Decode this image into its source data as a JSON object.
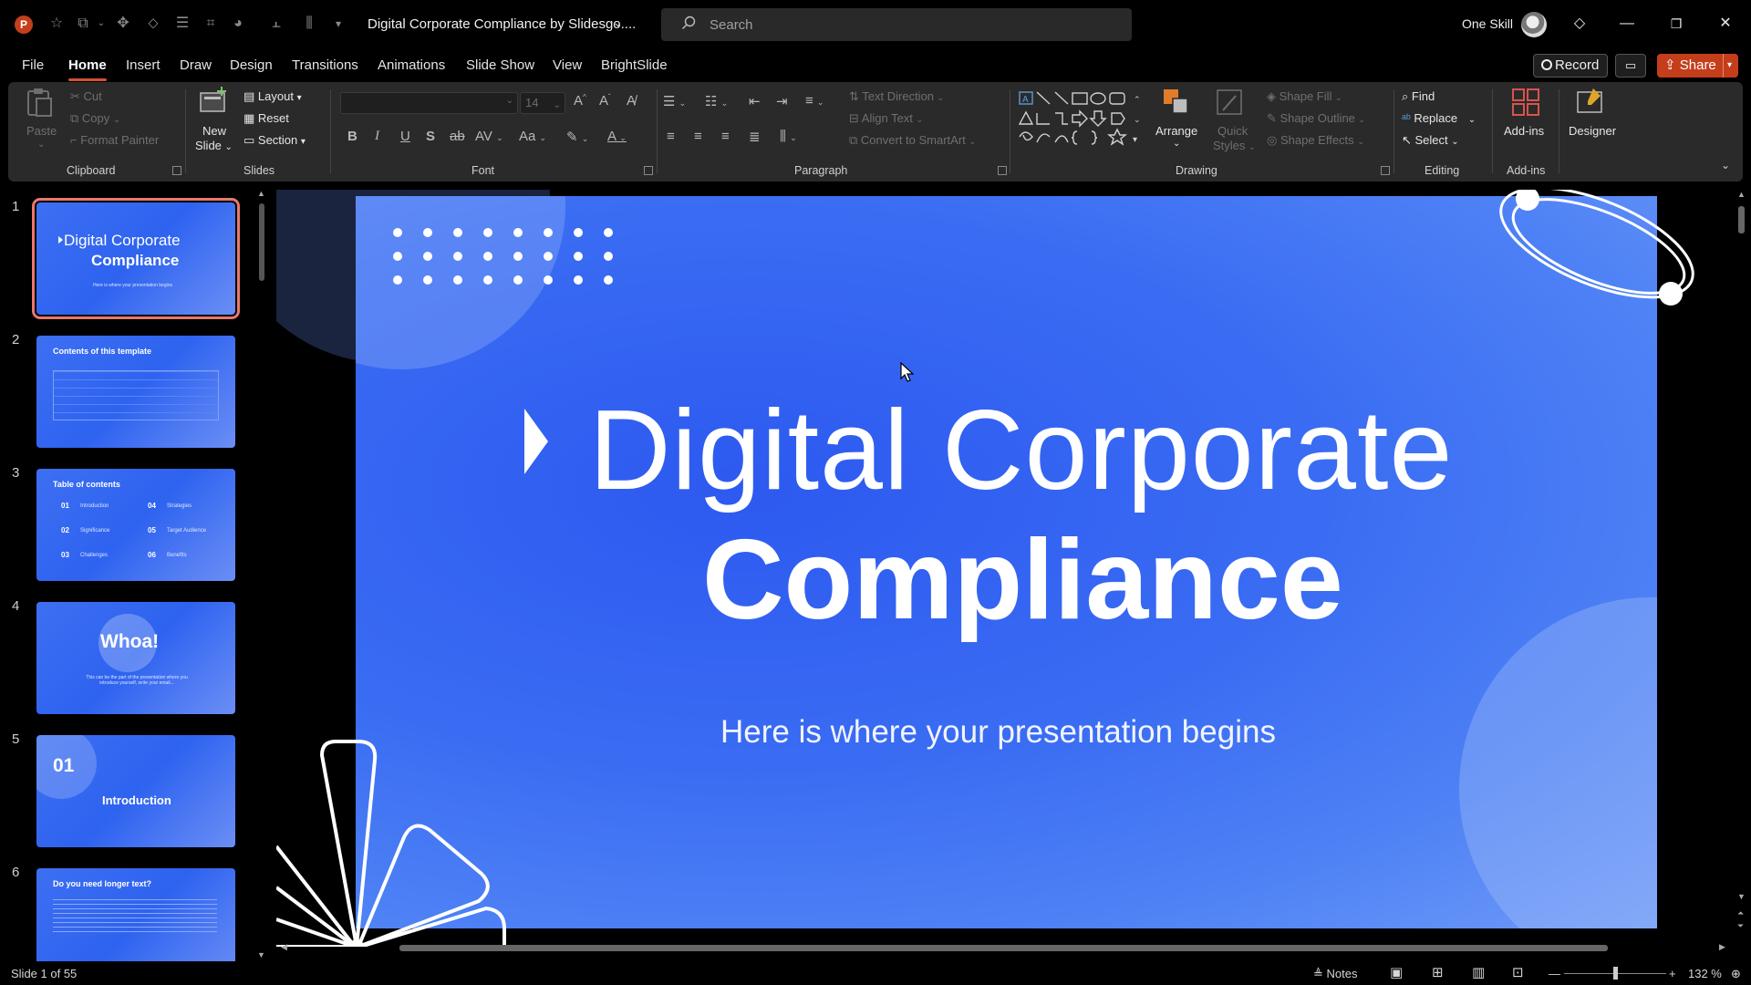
{
  "app": {
    "logo_letter": "P",
    "document_title": "Digital Corporate Compliance by Slidesgo....",
    "search_placeholder": "Search",
    "user_name": "One Skill"
  },
  "menu": {
    "tabs": [
      "File",
      "Home",
      "Insert",
      "Draw",
      "Design",
      "Transitions",
      "Animations",
      "Slide Show",
      "View",
      "BrightSlide"
    ],
    "active_tab": "Home",
    "record_label": "Record",
    "share_label": "Share"
  },
  "ribbon": {
    "clipboard": {
      "paste": "Paste",
      "cut": "Cut",
      "copy": "Copy",
      "format_painter": "Format Painter",
      "group": "Clipboard"
    },
    "slides": {
      "new_slide_1": "New",
      "new_slide_2": "Slide",
      "layout": "Layout",
      "reset": "Reset",
      "section": "Section",
      "group": "Slides"
    },
    "font": {
      "font_name": "",
      "font_size": "14",
      "group": "Font"
    },
    "paragraph": {
      "text_direction": "Text Direction",
      "align_text": "Align Text",
      "convert_smartart": "Convert to SmartArt",
      "group": "Paragraph"
    },
    "drawing": {
      "arrange": "Arrange",
      "quick_styles_1": "Quick",
      "quick_styles_2": "Styles",
      "shape_fill": "Shape Fill",
      "shape_outline": "Shape Outline",
      "shape_effects": "Shape Effects",
      "group": "Drawing"
    },
    "editing": {
      "find": "Find",
      "replace": "Replace",
      "select": "Select",
      "group": "Editing"
    },
    "addins": {
      "addins": "Add-ins",
      "designer": "Designer",
      "group": "Add-ins"
    }
  },
  "thumbnails": [
    {
      "num": "1",
      "title1": "Digital Corporate",
      "title2": "Compliance",
      "sub": "Here is where your presentation begins"
    },
    {
      "num": "2",
      "title1": "Contents of this template"
    },
    {
      "num": "3",
      "title1": "Table of contents",
      "items": [
        [
          "01",
          "Introduction"
        ],
        [
          "02",
          "Significance"
        ],
        [
          "03",
          "Challenges"
        ],
        [
          "04",
          "Strategies"
        ],
        [
          "05",
          "Target Audience"
        ],
        [
          "06",
          "Benefits"
        ]
      ]
    },
    {
      "num": "4",
      "title1": "Whoa!",
      "sub": "This can be the part of the presentation where you introduce yourself, write your email..."
    },
    {
      "num": "5",
      "title1": "01",
      "title2": "Introduction"
    },
    {
      "num": "6",
      "title1": "Do you need longer text?"
    }
  ],
  "slide": {
    "title_line1": "Digital Corporate",
    "title_line2": "Compliance",
    "subtitle": "Here is where your presentation begins"
  },
  "status": {
    "slide_counter": "Slide 1 of 55",
    "notes": "Notes",
    "zoom": "132 %"
  },
  "colors": {
    "accent": "#d35230",
    "share": "#c43e1c",
    "slide_blue": "#3a6cf3",
    "selected_outline": "#e8786b"
  }
}
